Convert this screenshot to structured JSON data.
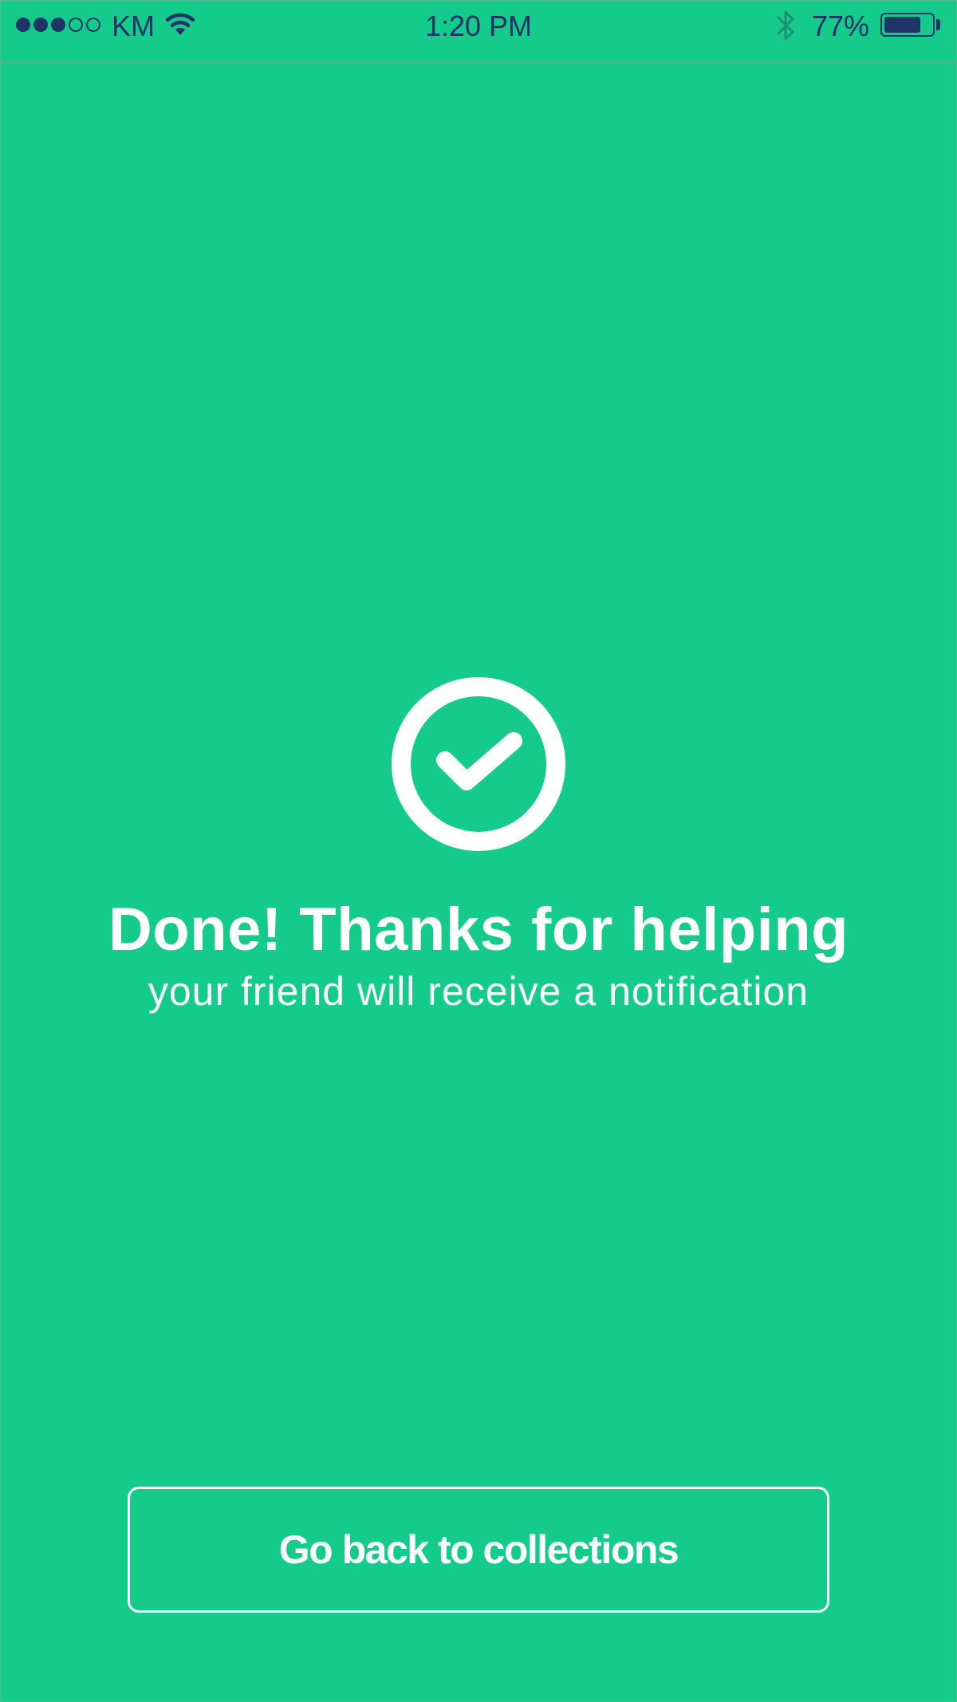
{
  "status_bar": {
    "signal_strength": 3,
    "signal_max": 5,
    "carrier": "KM",
    "time": "1:20 PM",
    "battery_percent": "77%",
    "battery_level": 0.77,
    "icons": [
      "signal-dots-icon",
      "wifi-icon",
      "bluetooth-icon",
      "battery-icon"
    ]
  },
  "confirmation": {
    "icon": "check-circle-icon",
    "title": "Done! Thanks for helping",
    "subtitle": "your friend will receive a notification"
  },
  "actions": {
    "back_button_label": "Go back to collections"
  },
  "colors": {
    "background": "#14cb8c",
    "status_text": "#1f3466",
    "foreground": "#ffffff"
  }
}
